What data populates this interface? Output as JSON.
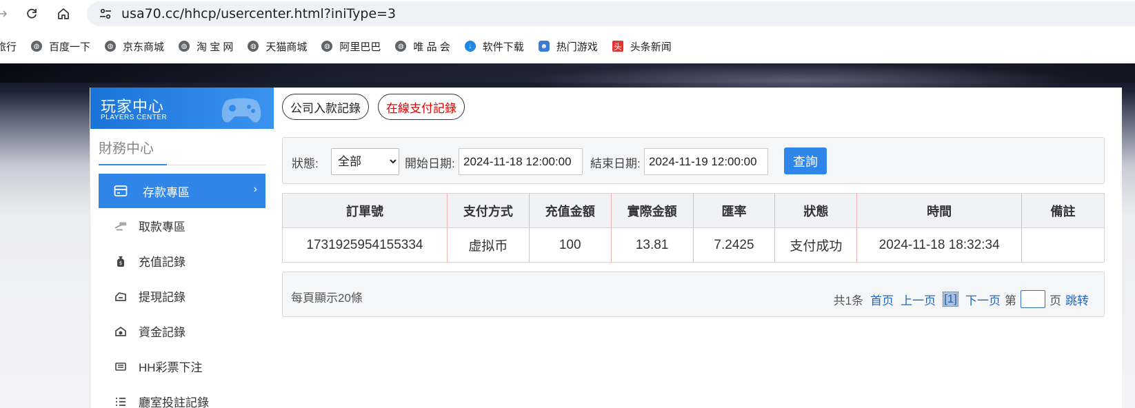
{
  "browser": {
    "url": "usa70.cc/hhcp/usercenter.html?iniType=3",
    "bookmarks": [
      {
        "label": "旅行",
        "icon": "none"
      },
      {
        "label": "百度一下",
        "icon": "globe-icon"
      },
      {
        "label": "京东商城",
        "icon": "globe-icon"
      },
      {
        "label": "淘 宝 网",
        "icon": "globe-icon"
      },
      {
        "label": "天猫商城",
        "icon": "globe-icon"
      },
      {
        "label": "阿里巴巴",
        "icon": "globe-icon"
      },
      {
        "label": "唯 品 会",
        "icon": "globe-icon"
      },
      {
        "label": "软件下载",
        "icon": "download-icon"
      },
      {
        "label": "热门游戏",
        "icon": "game-icon"
      },
      {
        "label": "头条新闻",
        "icon": "toutiao-icon"
      }
    ],
    "toutiao_badge": "头"
  },
  "sidebar": {
    "header_title": "玩家中心",
    "header_subtitle": "PLAYERS CENTER",
    "section_title": "財務中心",
    "items": [
      {
        "label": "存款專區",
        "icon": "card-icon",
        "active": true
      },
      {
        "label": "取款專區",
        "icon": "cash-icon",
        "active": false
      },
      {
        "label": "充值記錄",
        "icon": "moneybag-icon",
        "active": false
      },
      {
        "label": "提現記錄",
        "icon": "withdraw-icon",
        "active": false
      },
      {
        "label": "資金記錄",
        "icon": "funds-icon",
        "active": false
      },
      {
        "label": "HH彩票下注",
        "icon": "ticket-icon",
        "active": false
      },
      {
        "label": "廳室投註記錄",
        "icon": "list-icon",
        "active": false
      }
    ],
    "arrow": "›"
  },
  "tabs": [
    {
      "label": "公司入款記錄",
      "active": false
    },
    {
      "label": "在線支付記錄",
      "active": true
    }
  ],
  "filter": {
    "status_label": "狀態:",
    "status_value": "全部",
    "start_label": "開始日期:",
    "start_value": "2024-11-18 12:00:00",
    "end_label": "結束日期:",
    "end_value": "2024-11-19 12:00:00",
    "query_label": "查詢"
  },
  "table": {
    "headers": [
      "訂單號",
      "支付方式",
      "充值金額",
      "實際金額",
      "匯率",
      "狀態",
      "時間",
      "備註"
    ],
    "rows": [
      [
        "1731925954155334",
        "虚拟币",
        "100",
        "13.81",
        "7.2425",
        "支付成功",
        "2024-11-18 18:32:34",
        ""
      ]
    ]
  },
  "pager": {
    "per_page": "每頁顯示20條",
    "total": "共1条",
    "first": "首页",
    "prev": "上一页",
    "current": "[1]",
    "next": "下一页",
    "page_prefix": "第",
    "page_suffix": "页",
    "jump": "跳转"
  },
  "colors": {
    "accent": "#2f86e8",
    "active_tab_text": "#e00000",
    "link": "#1d66c2"
  }
}
